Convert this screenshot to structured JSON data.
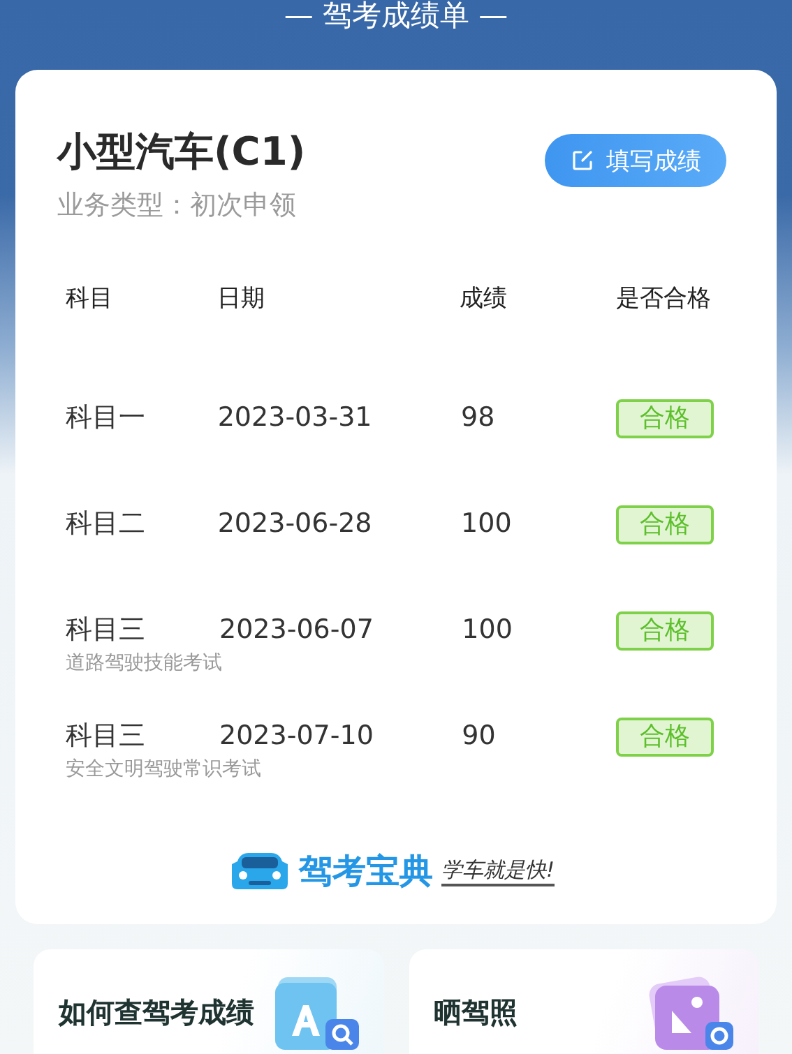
{
  "header": {
    "title": "— 驾考成绩单 —"
  },
  "card": {
    "title": "小型汽车(C1)",
    "subtitle": "业务类型：初次申领",
    "action_button": "填写成绩",
    "table": {
      "columns": [
        "科目",
        "日期",
        "成绩",
        "是否合格"
      ],
      "rows": [
        {
          "subject": "科目一",
          "date": "2023-03-31",
          "score": "98",
          "result": "合格",
          "passed": true
        },
        {
          "subject": "科目二",
          "date": "2023-06-28",
          "score": "100",
          "result": "合格",
          "passed": true
        },
        {
          "subject": "科目三",
          "note": "道路驾驶技能考试",
          "date": "2023-06-07",
          "score": "100",
          "result": "合格",
          "passed": true
        },
        {
          "subject": "科目三",
          "note": "安全文明驾驶常识考试",
          "date": "2023-07-10",
          "score": "90",
          "result": "合格",
          "passed": true
        }
      ]
    },
    "brand": {
      "name": "驾考宝典",
      "slogan": "学车就是快!"
    }
  },
  "tiles": [
    {
      "label": "如何查驾考成绩",
      "kind": "search"
    },
    {
      "label": "晒驾照",
      "kind": "photo"
    }
  ]
}
